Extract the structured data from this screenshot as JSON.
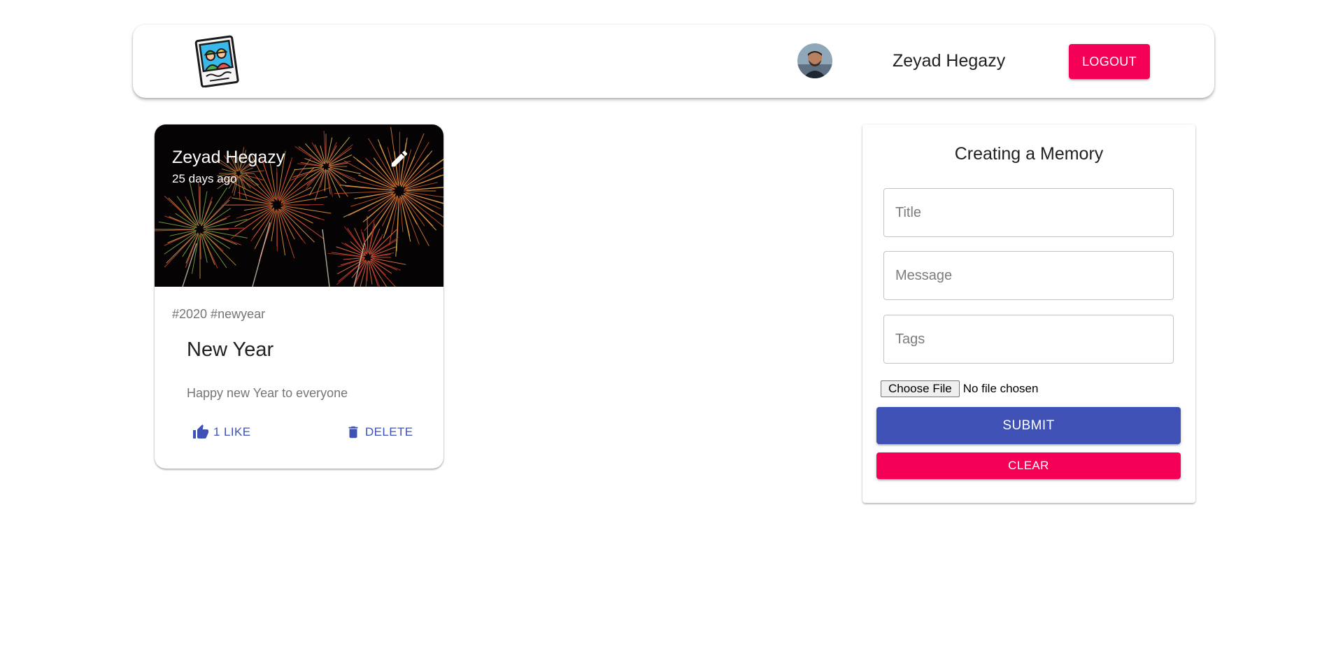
{
  "header": {
    "logo_icon": "memories-photo-icon",
    "avatar_icon": "user-avatar",
    "user_name": "Zeyad Hegazy",
    "logout_label": "LOGOUT",
    "logout_color": "#f50057"
  },
  "posts": [
    {
      "creator": "Zeyad Hegazy",
      "time_ago": "25 days ago",
      "tags": "#2020 #newyear",
      "title": "New Year",
      "message": "Happy new Year to everyone",
      "like_label": "1 LIKE",
      "delete_label": "DELETE",
      "media": "fireworks-image",
      "edit_icon": "pencil-icon",
      "like_icon": "thumb-up-icon",
      "delete_icon": "trash-icon"
    }
  ],
  "form": {
    "title": "Creating a Memory",
    "title_placeholder": "Title",
    "message_placeholder": "Message",
    "tags_placeholder": "Tags",
    "choose_file_label": "Choose File",
    "file_status": "No file chosen",
    "submit_label": "SUBMIT",
    "clear_label": "CLEAR",
    "submit_color": "#3f51b5",
    "clear_color": "#f50057"
  }
}
